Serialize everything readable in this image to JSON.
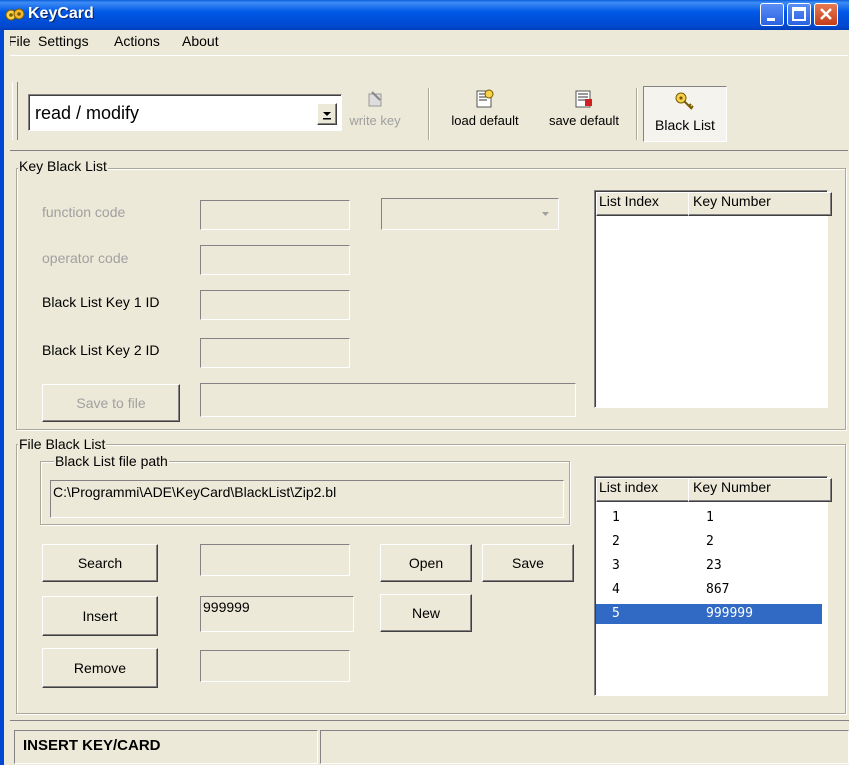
{
  "window": {
    "title": "KeyCard"
  },
  "menu": {
    "file": "File",
    "settings": "Settings",
    "actions": "Actions",
    "about": "About"
  },
  "toolbar": {
    "mode_select": "read / modify",
    "write_key": "write key",
    "load_default": "load default",
    "save_default": "save default",
    "black_list": "Black List"
  },
  "key_black_list": {
    "group_label": "Key Black List",
    "function_code_label": "function code",
    "function_code_value": "",
    "operator_code_label": "operator code",
    "operator_code_value": "",
    "key1_label": "Black List Key 1 ID",
    "key1_value": "",
    "key2_label": "Black List Key 2 ID",
    "key2_value": "",
    "save_to_file": "Save to file",
    "save_path_value": "",
    "list": {
      "col_index": "List Index",
      "col_key": "Key Number",
      "rows": []
    }
  },
  "file_black_list": {
    "group_label": "File Black List",
    "path_group_label": "Black List file path",
    "path_value": "C:\\Programmi\\ADE\\KeyCard\\BlackList\\Zip2.bl",
    "search_button": "Search",
    "search_value": "",
    "insert_button": "Insert",
    "insert_value": "999999",
    "remove_button": "Remove",
    "remove_value": "",
    "open_button": "Open",
    "save_button": "Save",
    "new_button": "New",
    "list": {
      "col_index": "List index",
      "col_key": "Key Number",
      "rows": [
        {
          "index": "1",
          "key": "1"
        },
        {
          "index": "2",
          "key": "2"
        },
        {
          "index": "3",
          "key": "23"
        },
        {
          "index": "4",
          "key": "867"
        },
        {
          "index": "5",
          "key": "999999",
          "selected": true
        }
      ]
    }
  },
  "status_bar": {
    "message": "INSERT KEY/CARD",
    "secondary": ""
  },
  "colors": {
    "titlebar": "#0054E3",
    "selection": "#316AC5",
    "face": "#ECE9D8"
  }
}
